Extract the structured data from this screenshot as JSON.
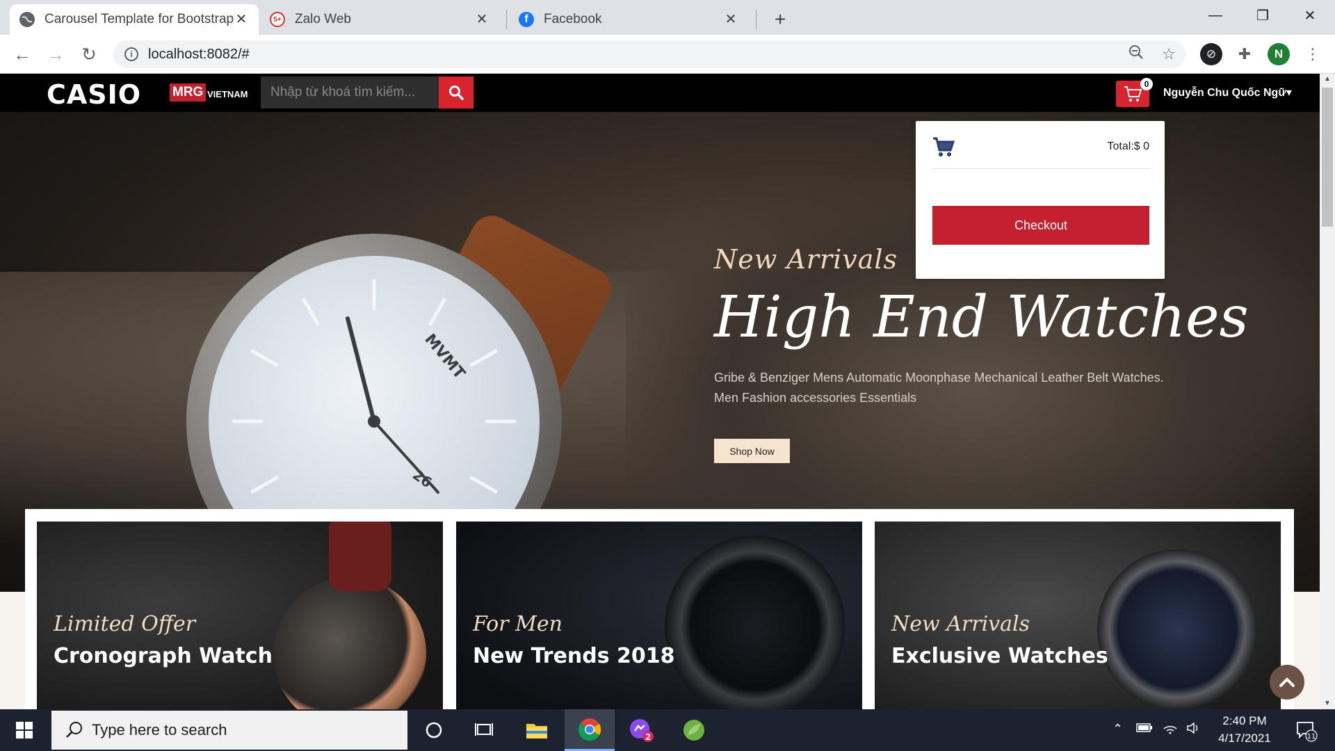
{
  "browser": {
    "tabs": [
      {
        "title": "Carousel Template for Bootstrap",
        "active": true
      },
      {
        "title": "Zalo Web",
        "badge": "5+"
      },
      {
        "title": "Facebook"
      }
    ],
    "new_tab": "+",
    "address": "localhost:8082/#",
    "profile_initial": "N"
  },
  "site": {
    "logo": "CASIO",
    "brand_badge": "MRG",
    "brand_sub": "VIETNAM",
    "search_placeholder": "Nhập từ khoá tìm kiếm...",
    "cart_count": "0",
    "user_name": "Nguyễn Chu Quốc Ngữ"
  },
  "cart_dropdown": {
    "total": "Total:$ 0",
    "checkout": "Checkout"
  },
  "hero": {
    "watch_brand": "MVMT",
    "date": "26",
    "subtitle": "New Arrivals",
    "title": "High End Watches",
    "description_line1": "Gribe & Benziger Mens Automatic Moonphase Mechanical Leather Belt Watches.",
    "description_line2": "Men Fashion accessories Essentials",
    "button": "Shop Now"
  },
  "cards": [
    {
      "script": "Limited Offer",
      "name": "Cronograph Watch"
    },
    {
      "script": "For Men",
      "name": "New Trends 2018"
    },
    {
      "script": "New Arrivals",
      "name": "Exclusive Watches"
    }
  ],
  "taskbar": {
    "search_placeholder": "Type here to search",
    "time": "2:40 PM",
    "date": "4/17/2021",
    "messenger_badge": "2",
    "notification_count": "11"
  },
  "colors": {
    "accent_red": "#c4202f",
    "nav_black": "#000000",
    "hero_gold": "#f3d9bd"
  }
}
